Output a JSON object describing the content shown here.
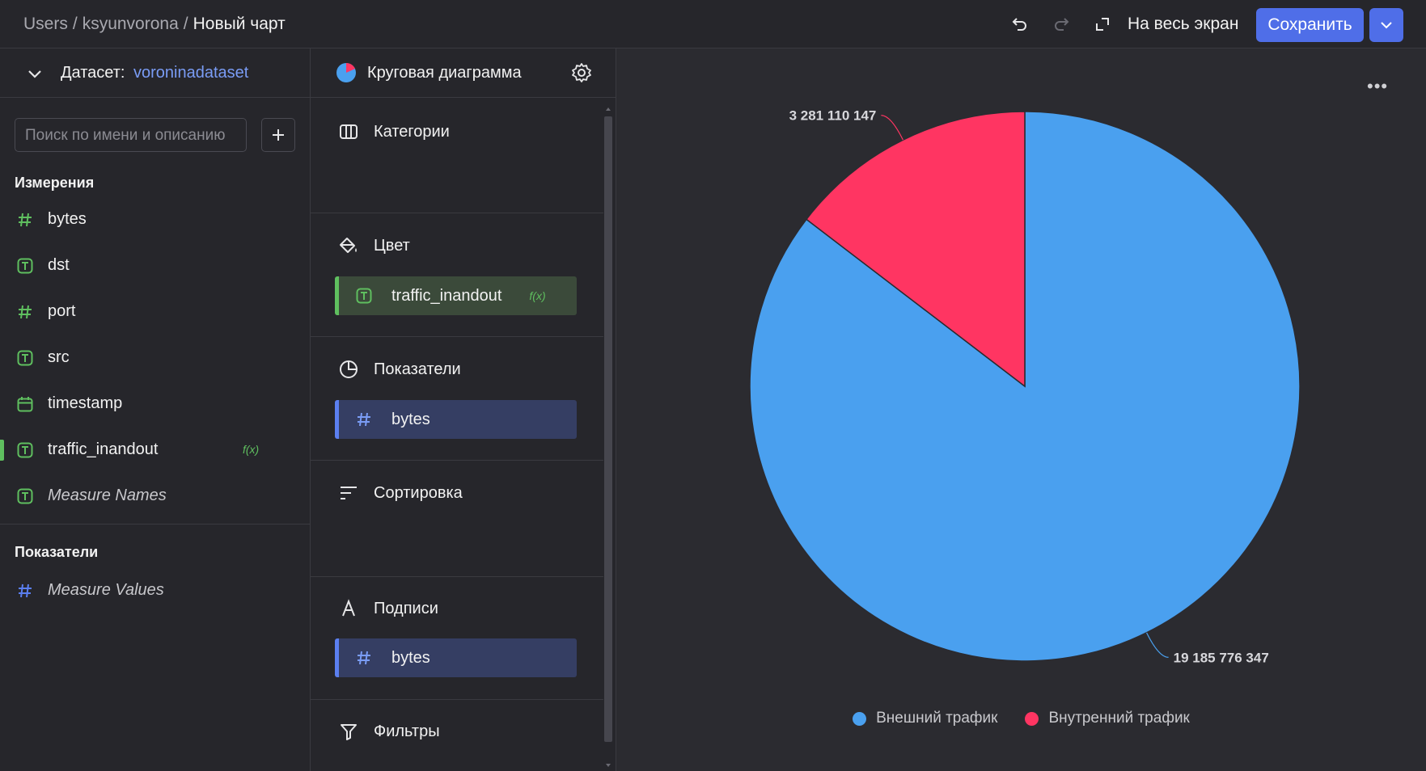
{
  "header": {
    "breadcrumb": [
      "Users",
      "ksyunvorona"
    ],
    "current_title": "Новый чарт",
    "fullscreen_label": "На весь экран",
    "save_label": "Сохранить"
  },
  "dataset": {
    "label": "Датасет:",
    "name": "voroninadataset"
  },
  "search": {
    "placeholder": "Поиск по имени и описанию"
  },
  "dimensions": {
    "title": "Измерения",
    "items": [
      {
        "name": "bytes",
        "icon": "number-icon"
      },
      {
        "name": "dst",
        "icon": "text-type-icon"
      },
      {
        "name": "port",
        "icon": "number-icon"
      },
      {
        "name": "src",
        "icon": "text-type-icon"
      },
      {
        "name": "timestamp",
        "icon": "calendar-icon"
      },
      {
        "name": "traffic_inandout",
        "icon": "text-type-icon",
        "badge": "f(x)"
      },
      {
        "name": "Measure Names",
        "icon": "text-type-icon"
      }
    ]
  },
  "measures": {
    "title": "Показатели",
    "items": [
      {
        "name": "Measure Values",
        "icon": "number-icon"
      }
    ]
  },
  "visualization": {
    "type_label": "Круговая диаграмма",
    "sections": {
      "categories": "Категории",
      "color": "Цвет",
      "measures": "Показатели",
      "sorting": "Сортировка",
      "labels": "Подписи",
      "filters": "Фильтры"
    },
    "color_field": {
      "name": "traffic_inandout",
      "badge": "f(x)"
    },
    "measure_field": {
      "name": "bytes"
    },
    "label_field": {
      "name": "bytes"
    }
  },
  "colors": {
    "accent": "#4f6ee8",
    "slice_external": "#4aa0ef",
    "slice_internal": "#ff3562",
    "dimension_green": "#5fbf5f"
  },
  "chart_data": {
    "type": "pie",
    "categories": [
      "Внешний трафик",
      "Внутренний трафик"
    ],
    "values": [
      19185776347,
      3281110147
    ],
    "data_labels": [
      "19 185 776 347",
      "3 281 110 147"
    ],
    "colors": [
      "#4aa0ef",
      "#ff3562"
    ],
    "title": "",
    "legend_position": "bottom"
  }
}
